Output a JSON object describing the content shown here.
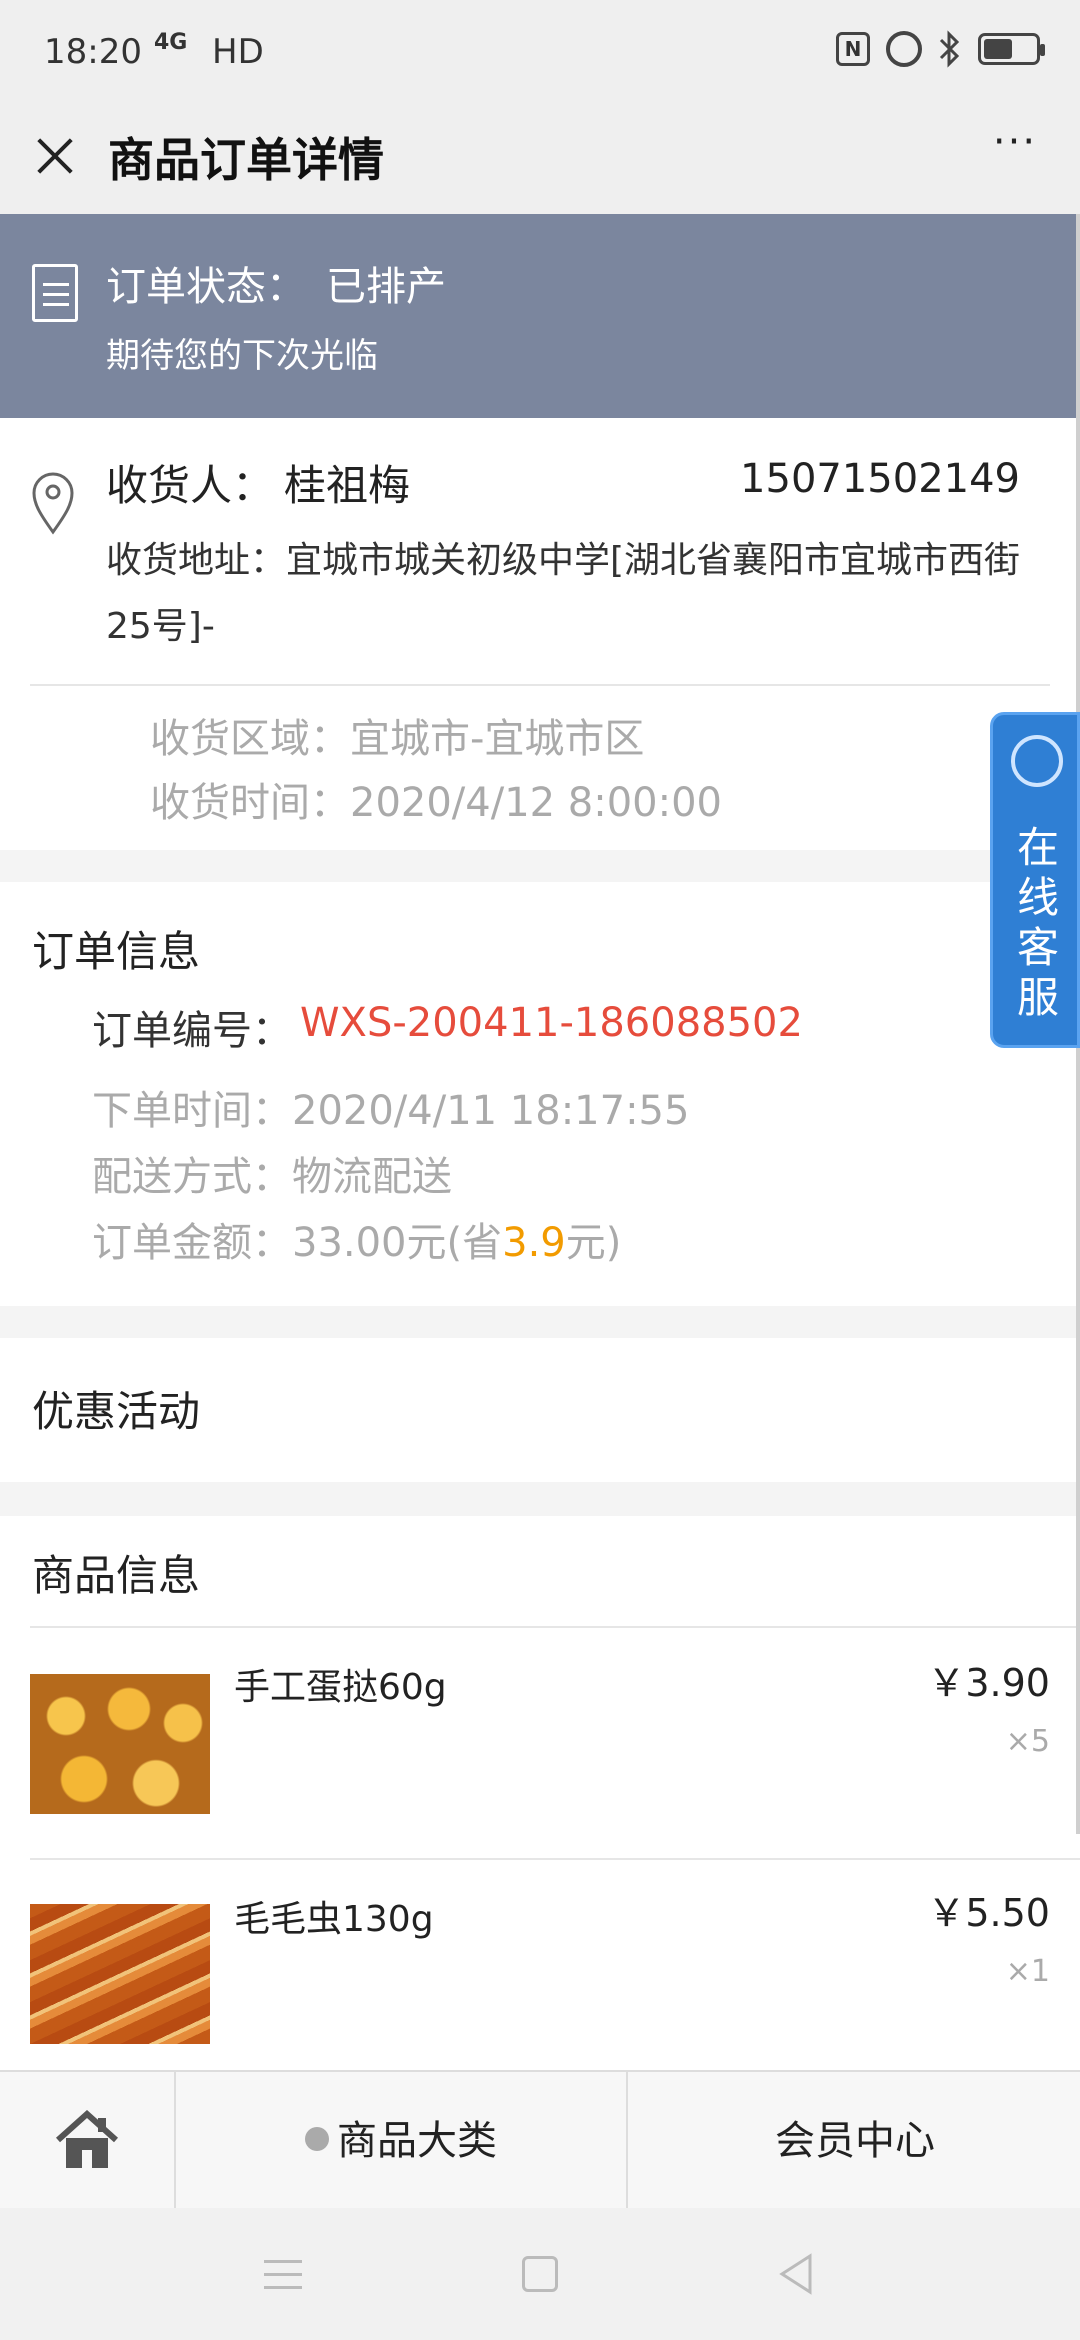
{
  "statusbar": {
    "time": "18:20",
    "network": "4G",
    "hd": "HD",
    "nfc": "N"
  },
  "titlebar": {
    "title": "商品订单详情",
    "more": "···"
  },
  "order_status": {
    "label": "订单状态：",
    "value": "已排产",
    "subtitle": "期待您的下次光临"
  },
  "recipient": {
    "label": "收货人：",
    "name": "桂祖梅",
    "phone": "15071502149",
    "address": "收货地址：宜城市城关初级中学[湖北省襄阳市宜城市西街25号]-",
    "area": "收货区域：宜城市-宜城市区",
    "time": "收货时间：2020/4/12 8:00:00"
  },
  "order_info": {
    "heading": "订单信息",
    "number_label": "订单编号：",
    "number": "WXS-200411-186088502",
    "placed_time": "下单时间：2020/4/11 18:17:55",
    "delivery": "配送方式：物流配送",
    "amount_prefix": "订单金额：33.00元(省",
    "amount_saved": "3.9",
    "amount_suffix": "元)"
  },
  "promotion": {
    "heading": "优惠活动"
  },
  "goods": {
    "heading": "商品信息",
    "items": [
      {
        "name": "手工蛋挞60g",
        "price": "￥3.90",
        "qty": "×5"
      },
      {
        "name": "毛毛虫130g",
        "price": "￥5.50",
        "qty": "×1"
      }
    ]
  },
  "service": {
    "label": "在线客服"
  },
  "bottom_nav": {
    "category": "商品大类",
    "member": "会员中心"
  },
  "colors": {
    "status_band": "#7b869e",
    "order_number": "#e64c3c",
    "saved_amount": "#f29b00",
    "service": "#2f7fd4"
  }
}
